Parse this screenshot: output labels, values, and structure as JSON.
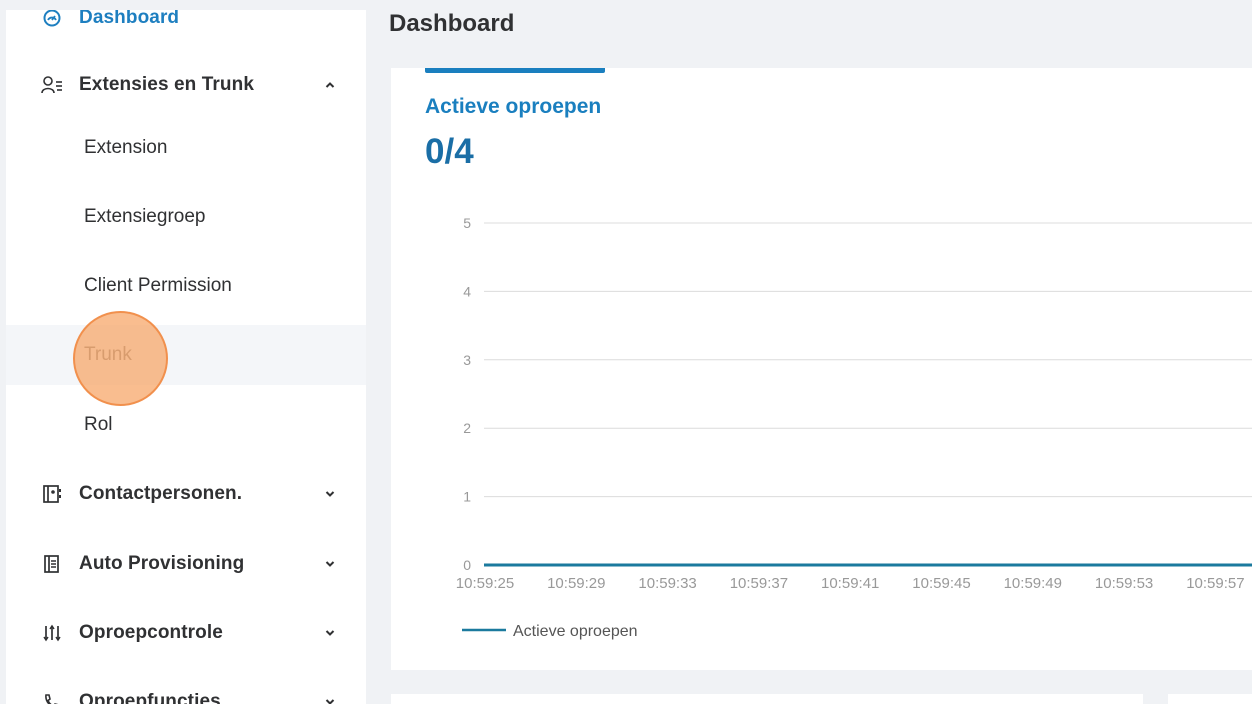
{
  "page": {
    "title": "Dashboard"
  },
  "sidebar": {
    "dashboard": {
      "label": "Dashboard",
      "icon": "dashboard-icon"
    },
    "extensions_group": {
      "label": "Extensies en Trunk",
      "icon": "users-icon",
      "expanded": true,
      "items": [
        {
          "label": "Extension"
        },
        {
          "label": "Extensiegroep"
        },
        {
          "label": "Client Permission"
        },
        {
          "label": "Trunk"
        },
        {
          "label": "Rol"
        }
      ]
    },
    "menus": [
      {
        "label": "Contactpersonen.",
        "icon": "contacts-icon"
      },
      {
        "label": "Auto Provisioning",
        "icon": "provisioning-icon"
      },
      {
        "label": "Oproepcontrole",
        "icon": "sort-icon"
      },
      {
        "label": "Oproepfuncties",
        "icon": "phone-icon"
      }
    ]
  },
  "card": {
    "title": "Actieve oproepen",
    "value": "0/4"
  },
  "chart_data": {
    "type": "line",
    "x": [
      "10:59:25",
      "10:59:29",
      "10:59:33",
      "10:59:37",
      "10:59:41",
      "10:59:45",
      "10:59:49",
      "10:59:53",
      "10:59:57"
    ],
    "series": [
      {
        "name": "Actieve oproepen",
        "values": [
          0,
          0,
          0,
          0,
          0,
          0,
          0,
          0,
          0
        ]
      }
    ],
    "yticks": [
      0,
      1,
      2,
      3,
      4,
      5
    ],
    "ylim": [
      0,
      5
    ],
    "grid": true,
    "legend": "bottom-left",
    "colors": {
      "series": "#1b7a9e",
      "grid": "#dcdcdc",
      "axis_text": "#999999"
    }
  },
  "colors": {
    "accent": "#1a7fbf",
    "background": "#f0f2f5"
  }
}
